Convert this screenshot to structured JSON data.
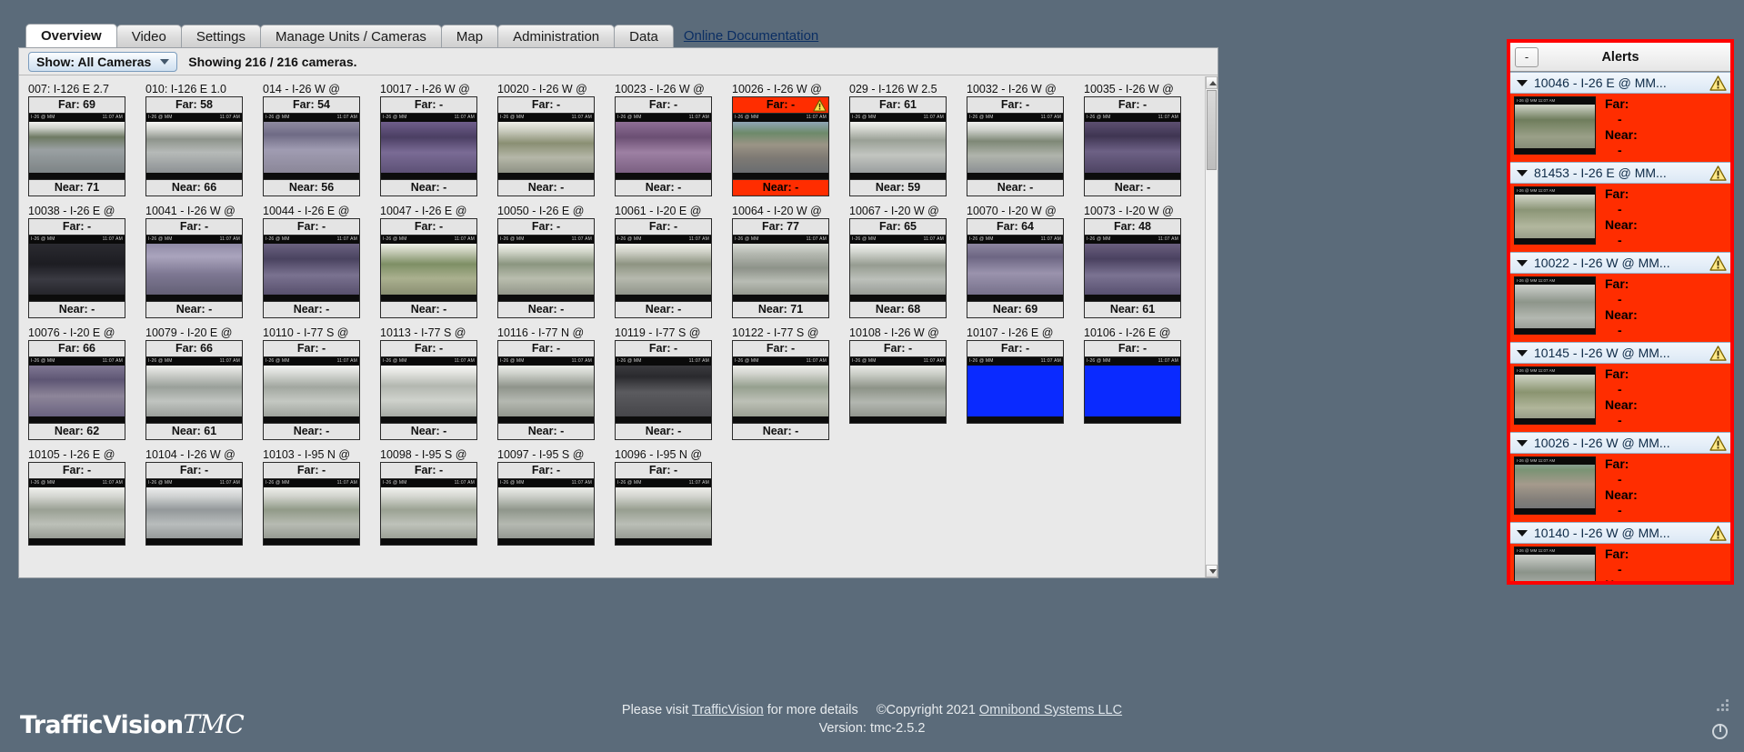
{
  "tabs": [
    {
      "label": "Overview",
      "active": true
    },
    {
      "label": "Video",
      "active": false
    },
    {
      "label": "Settings",
      "active": false
    },
    {
      "label": "Manage Units / Cameras",
      "active": false
    },
    {
      "label": "Map",
      "active": false
    },
    {
      "label": "Administration",
      "active": false
    },
    {
      "label": "Data",
      "active": false
    }
  ],
  "doc_link": "Online Documentation",
  "toolbar": {
    "show_filter": "Show: All Cameras",
    "showing": "Showing 216 / 216 cameras."
  },
  "cameras": [
    {
      "title": "007: I-126 E 2.7",
      "far": "Far: 69",
      "near": "Near: 71",
      "alarm": false,
      "scene": "a"
    },
    {
      "title": "010: I-126 E 1.0",
      "far": "Far: 58",
      "near": "Near: 66",
      "alarm": false,
      "scene": "b"
    },
    {
      "title": "014 - I-26 W @",
      "far": "Far: 54",
      "near": "Near: 56",
      "alarm": false,
      "scene": "c"
    },
    {
      "title": "10017 - I-26 W @",
      "far": "Far: -",
      "near": "Near: -",
      "alarm": false,
      "scene": "d"
    },
    {
      "title": "10020 - I-26 W @",
      "far": "Far: -",
      "near": "Near: -",
      "alarm": false,
      "scene": "e"
    },
    {
      "title": "10023 - I-26 W @",
      "far": "Far: -",
      "near": "Near: -",
      "alarm": false,
      "scene": "f"
    },
    {
      "title": "10026 - I-26 W @",
      "far": "Far: -",
      "near": "Near: -",
      "alarm": true,
      "scene": "g"
    },
    {
      "title": "029 - I-126 W 2.5",
      "far": "Far: 61",
      "near": "Near: 59",
      "alarm": false,
      "scene": "h"
    },
    {
      "title": "10032 - I-26 W @",
      "far": "Far: -",
      "near": "Near: -",
      "alarm": false,
      "scene": "i"
    },
    {
      "title": "10035 - I-26 W @",
      "far": "Far: -",
      "near": "Near: -",
      "alarm": false,
      "scene": "j"
    },
    {
      "title": "10038 - I-26 E @",
      "far": "Far: -",
      "near": "Near: -",
      "alarm": false,
      "scene": "k"
    },
    {
      "title": "10041 - I-26 W @",
      "far": "Far: -",
      "near": "Near: -",
      "alarm": false,
      "scene": "l"
    },
    {
      "title": "10044 - I-26 E @",
      "far": "Far: -",
      "near": "Near: -",
      "alarm": false,
      "scene": "m"
    },
    {
      "title": "10047 - I-26 E @",
      "far": "Far: -",
      "near": "Near: -",
      "alarm": false,
      "scene": "n"
    },
    {
      "title": "10050 - I-26 E @",
      "far": "Far: -",
      "near": "Near: -",
      "alarm": false,
      "scene": "o"
    },
    {
      "title": "10061 - I-20 E @",
      "far": "Far: -",
      "near": "Near: -",
      "alarm": false,
      "scene": "p"
    },
    {
      "title": "10064 - I-20 W @",
      "far": "Far: 77",
      "near": "Near: 71",
      "alarm": false,
      "scene": "q"
    },
    {
      "title": "10067 - I-20 W @",
      "far": "Far: 65",
      "near": "Near: 68",
      "alarm": false,
      "scene": "r"
    },
    {
      "title": "10070 - I-20 W @",
      "far": "Far: 64",
      "near": "Near: 69",
      "alarm": false,
      "scene": "s"
    },
    {
      "title": "10073 - I-20 W @",
      "far": "Far: 48",
      "near": "Near: 61",
      "alarm": false,
      "scene": "t"
    },
    {
      "title": "10076 - I-20 E @",
      "far": "Far: 66",
      "near": "Near: 62",
      "alarm": false,
      "scene": "u"
    },
    {
      "title": "10079 - I-20 E @",
      "far": "Far: 66",
      "near": "Near: 61",
      "alarm": false,
      "scene": "v"
    },
    {
      "title": "10110 - I-77 S @",
      "far": "Far: -",
      "near": "Near: -",
      "alarm": false,
      "scene": "w"
    },
    {
      "title": "10113 - I-77 S @",
      "far": "Far: -",
      "near": "Near: -",
      "alarm": false,
      "scene": "x"
    },
    {
      "title": "10116 - I-77 N @",
      "far": "Far: -",
      "near": "Near: -",
      "alarm": false,
      "scene": "y"
    },
    {
      "title": "10119 - I-77 S @",
      "far": "Far: -",
      "near": "Near: -",
      "alarm": false,
      "scene": "z"
    },
    {
      "title": "10122 - I-77 S @",
      "far": "Far: -",
      "near": "Near: -",
      "alarm": false,
      "scene": "a2"
    },
    {
      "title": "10108 - I-26 W @",
      "far": "Far: -",
      "near": "",
      "alarm": false,
      "scene": "b2"
    },
    {
      "title": "10107 - I-26 E @",
      "far": "Far: -",
      "near": "",
      "alarm": false,
      "scene": "blue"
    },
    {
      "title": "10106 - I-26 E @",
      "far": "Far: -",
      "near": "",
      "alarm": false,
      "scene": "blue"
    },
    {
      "title": "10105 - I-26 E @",
      "far": "Far: -",
      "near": "",
      "alarm": false,
      "scene": "c2"
    },
    {
      "title": "10104 - I-26 W @",
      "far": "Far: -",
      "near": "",
      "alarm": false,
      "scene": "d2"
    },
    {
      "title": "10103 - I-95 N @",
      "far": "Far: -",
      "near": "",
      "alarm": false,
      "scene": "e2"
    },
    {
      "title": "10098 - I-95 S @",
      "far": "Far: -",
      "near": "",
      "alarm": false,
      "scene": "f2"
    },
    {
      "title": "10097 - I-95 S @",
      "far": "Far: -",
      "near": "",
      "alarm": false,
      "scene": "g2"
    },
    {
      "title": "10096 - I-95 N @",
      "far": "Far: -",
      "near": "",
      "alarm": false,
      "scene": "h2"
    }
  ],
  "alerts": {
    "title": "Alerts",
    "collapse_label": "-",
    "items": [
      {
        "name": "10046 - I-26 E @ MM...",
        "far_label": "Far:",
        "far": "-",
        "near_label": "Near:",
        "near": "-"
      },
      {
        "name": "81453 - I-26 E @ MM...",
        "far_label": "Far:",
        "far": "-",
        "near_label": "Near:",
        "near": "-"
      },
      {
        "name": "10022 - I-26 W @ MM...",
        "far_label": "Far:",
        "far": "-",
        "near_label": "Near:",
        "near": "-"
      },
      {
        "name": "10145 - I-26 W @ MM...",
        "far_label": "Far:",
        "far": "-",
        "near_label": "Near:",
        "near": "-"
      },
      {
        "name": "10026 - I-26 W @ MM...",
        "far_label": "Far:",
        "far": "-",
        "near_label": "Near:",
        "near": "-"
      },
      {
        "name": "10140 - I-26 W @ MM...",
        "far_label": "Far:",
        "far": "-",
        "near_label": "Near:",
        "near": "-"
      }
    ]
  },
  "branding": {
    "logo_main": "TrafficVision",
    "logo_suffix": "TMC"
  },
  "footer": {
    "visit_prefix": "Please visit ",
    "visit_link": "TrafficVision",
    "visit_suffix": " for more details",
    "copyright": "©Copyright 2021 ",
    "company_link": "Omnibond Systems LLC",
    "version": "Version: tmc-2.5.2"
  },
  "colors": {
    "alert_red": "#ff2d00",
    "panel_border_red": "#ff0000",
    "desktop": "#5b6b7a",
    "content_bg": "#e9e9e9"
  }
}
